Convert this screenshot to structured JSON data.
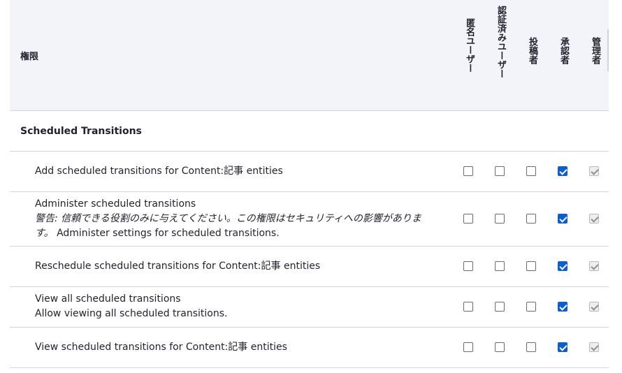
{
  "header": {
    "permission_label": "権限",
    "roles": [
      "匿名ユーザー",
      "認証済みユーザー",
      "投稿者",
      "承認者",
      "管理者"
    ]
  },
  "group": {
    "title": "Scheduled Transitions"
  },
  "permissions": [
    {
      "name": "Add scheduled transitions for Content:記事 entities",
      "warning": "",
      "description": "",
      "checks": [
        false,
        false,
        false,
        true,
        true
      ]
    },
    {
      "name": "Administer scheduled transitions",
      "warning": "警告: 信頼できる役割のみに与えてください。この権限はセキュリティへの影響がありま",
      "warning_end": "す。",
      "description": "Administer settings for scheduled transitions.",
      "checks": [
        false,
        false,
        false,
        true,
        true
      ]
    },
    {
      "name": "Reschedule scheduled transitions for Content:記事 entities",
      "warning": "",
      "description": "",
      "checks": [
        false,
        false,
        false,
        true,
        true
      ]
    },
    {
      "name": "View all scheduled transitions",
      "warning": "",
      "description": "Allow viewing all scheduled transitions.",
      "checks": [
        false,
        false,
        false,
        true,
        true
      ]
    },
    {
      "name": "View scheduled transitions for Content:記事 entities",
      "warning": "",
      "description": "",
      "checks": [
        false,
        false,
        false,
        true,
        true
      ]
    }
  ],
  "colors": {
    "accent": "#0b5ecf",
    "header_bg": "#f3f4f9",
    "border": "#d3d4d9"
  }
}
